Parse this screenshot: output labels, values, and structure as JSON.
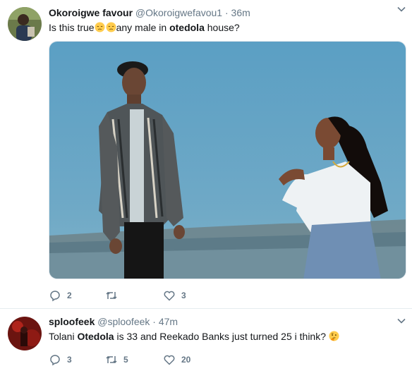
{
  "tweets": [
    {
      "name": "Okoroigwe favour",
      "handle": "@Okoroigwefavou1",
      "dot": "·",
      "time": "36m",
      "text_pre": "Is this true",
      "text_mid": "any male in ",
      "text_bold": "otedola",
      "text_post": " house?",
      "emoji": [
        "pensive-face-icon",
        "pensive-face-icon"
      ],
      "replies": "2",
      "retweets": "",
      "likes": "3"
    },
    {
      "name": "sploofeek",
      "handle": "@sploofeek",
      "dot": "·",
      "time": "47m",
      "text_pre": "Tolani ",
      "text_bold": "Otedola",
      "text_post": " is 33 and Reekado Banks just turned 25 i think? ",
      "emoji": [
        "thinking-face-icon"
      ],
      "replies": "3",
      "retweets": "5",
      "likes": "20"
    }
  ],
  "colors": {
    "text": "#14171a",
    "secondary": "#657786",
    "divider": "#e6ecf0",
    "sky": "#5f9cbd"
  }
}
